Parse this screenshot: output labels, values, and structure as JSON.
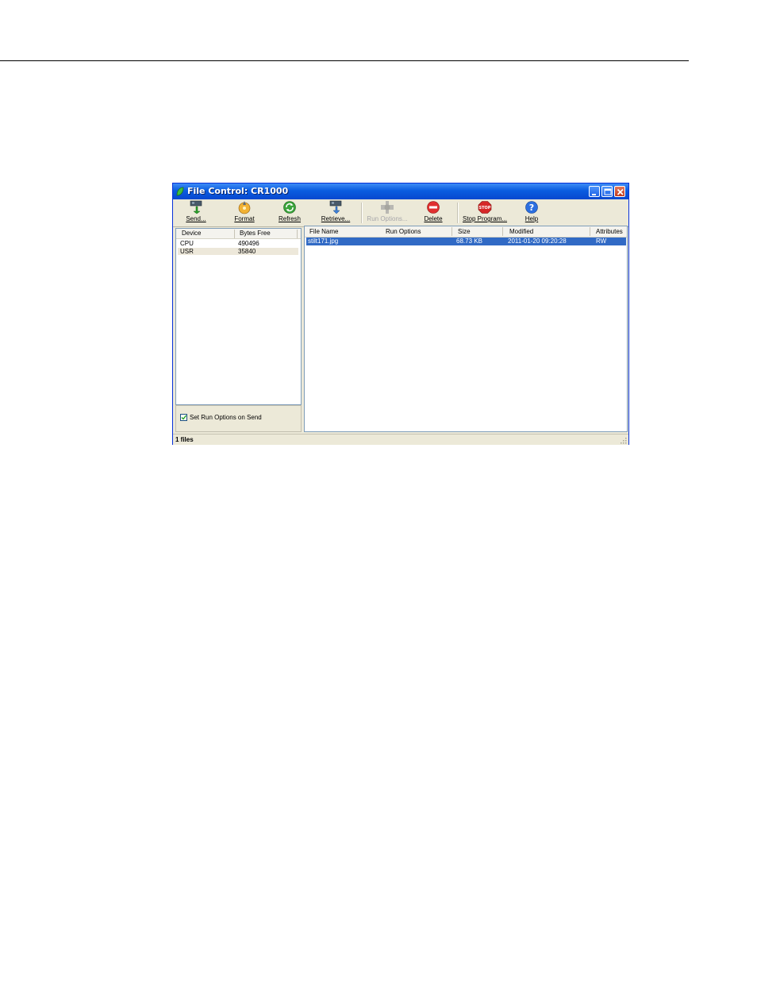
{
  "window": {
    "title": "File Control: CR1000"
  },
  "toolbar": {
    "send": "Send...",
    "format": "Format",
    "refresh": "Refresh",
    "retrieve": "Retrieve...",
    "run_options": "Run Options...",
    "delete": "Delete",
    "stop_program": "Stop Program...",
    "help": "Help"
  },
  "device_list": {
    "headers": {
      "device": "Device",
      "bytes_free": "Bytes Free"
    },
    "rows": [
      {
        "device": "CPU",
        "bytes_free": "490496"
      },
      {
        "device": "USR",
        "bytes_free": "35840"
      }
    ]
  },
  "options": {
    "set_run_options_label": "Set Run Options on Send",
    "set_run_options_checked": true
  },
  "file_list": {
    "headers": {
      "file_name": "File Name",
      "run_options": "Run Options",
      "size": "Size",
      "modified": "Modified",
      "attributes": "Attributes"
    },
    "rows": [
      {
        "file_name": "stilt171.jpg",
        "run_options": "",
        "size": "68.73 KB",
        "modified": "2011-01-20 09:20:28",
        "attributes": "RW"
      }
    ]
  },
  "status": {
    "text": "1 files"
  },
  "colors": {
    "title_bar": "#0a5ce0",
    "selection": "#316ac5",
    "window_face": "#ece9d8"
  }
}
